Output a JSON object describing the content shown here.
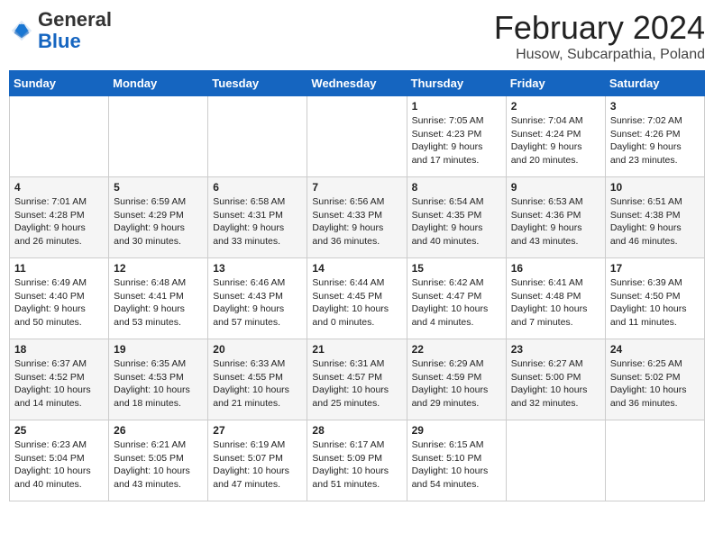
{
  "header": {
    "logo_general": "General",
    "logo_blue": "Blue",
    "main_title": "February 2024",
    "subtitle": "Husow, Subcarpathia, Poland"
  },
  "days_of_week": [
    "Sunday",
    "Monday",
    "Tuesday",
    "Wednesday",
    "Thursday",
    "Friday",
    "Saturday"
  ],
  "weeks": [
    [
      {
        "day": "",
        "text": ""
      },
      {
        "day": "",
        "text": ""
      },
      {
        "day": "",
        "text": ""
      },
      {
        "day": "",
        "text": ""
      },
      {
        "day": "1",
        "text": "Sunrise: 7:05 AM\nSunset: 4:23 PM\nDaylight: 9 hours and 17 minutes."
      },
      {
        "day": "2",
        "text": "Sunrise: 7:04 AM\nSunset: 4:24 PM\nDaylight: 9 hours and 20 minutes."
      },
      {
        "day": "3",
        "text": "Sunrise: 7:02 AM\nSunset: 4:26 PM\nDaylight: 9 hours and 23 minutes."
      }
    ],
    [
      {
        "day": "4",
        "text": "Sunrise: 7:01 AM\nSunset: 4:28 PM\nDaylight: 9 hours and 26 minutes."
      },
      {
        "day": "5",
        "text": "Sunrise: 6:59 AM\nSunset: 4:29 PM\nDaylight: 9 hours and 30 minutes."
      },
      {
        "day": "6",
        "text": "Sunrise: 6:58 AM\nSunset: 4:31 PM\nDaylight: 9 hours and 33 minutes."
      },
      {
        "day": "7",
        "text": "Sunrise: 6:56 AM\nSunset: 4:33 PM\nDaylight: 9 hours and 36 minutes."
      },
      {
        "day": "8",
        "text": "Sunrise: 6:54 AM\nSunset: 4:35 PM\nDaylight: 9 hours and 40 minutes."
      },
      {
        "day": "9",
        "text": "Sunrise: 6:53 AM\nSunset: 4:36 PM\nDaylight: 9 hours and 43 minutes."
      },
      {
        "day": "10",
        "text": "Sunrise: 6:51 AM\nSunset: 4:38 PM\nDaylight: 9 hours and 46 minutes."
      }
    ],
    [
      {
        "day": "11",
        "text": "Sunrise: 6:49 AM\nSunset: 4:40 PM\nDaylight: 9 hours and 50 minutes."
      },
      {
        "day": "12",
        "text": "Sunrise: 6:48 AM\nSunset: 4:41 PM\nDaylight: 9 hours and 53 minutes."
      },
      {
        "day": "13",
        "text": "Sunrise: 6:46 AM\nSunset: 4:43 PM\nDaylight: 9 hours and 57 minutes."
      },
      {
        "day": "14",
        "text": "Sunrise: 6:44 AM\nSunset: 4:45 PM\nDaylight: 10 hours and 0 minutes."
      },
      {
        "day": "15",
        "text": "Sunrise: 6:42 AM\nSunset: 4:47 PM\nDaylight: 10 hours and 4 minutes."
      },
      {
        "day": "16",
        "text": "Sunrise: 6:41 AM\nSunset: 4:48 PM\nDaylight: 10 hours and 7 minutes."
      },
      {
        "day": "17",
        "text": "Sunrise: 6:39 AM\nSunset: 4:50 PM\nDaylight: 10 hours and 11 minutes."
      }
    ],
    [
      {
        "day": "18",
        "text": "Sunrise: 6:37 AM\nSunset: 4:52 PM\nDaylight: 10 hours and 14 minutes."
      },
      {
        "day": "19",
        "text": "Sunrise: 6:35 AM\nSunset: 4:53 PM\nDaylight: 10 hours and 18 minutes."
      },
      {
        "day": "20",
        "text": "Sunrise: 6:33 AM\nSunset: 4:55 PM\nDaylight: 10 hours and 21 minutes."
      },
      {
        "day": "21",
        "text": "Sunrise: 6:31 AM\nSunset: 4:57 PM\nDaylight: 10 hours and 25 minutes."
      },
      {
        "day": "22",
        "text": "Sunrise: 6:29 AM\nSunset: 4:59 PM\nDaylight: 10 hours and 29 minutes."
      },
      {
        "day": "23",
        "text": "Sunrise: 6:27 AM\nSunset: 5:00 PM\nDaylight: 10 hours and 32 minutes."
      },
      {
        "day": "24",
        "text": "Sunrise: 6:25 AM\nSunset: 5:02 PM\nDaylight: 10 hours and 36 minutes."
      }
    ],
    [
      {
        "day": "25",
        "text": "Sunrise: 6:23 AM\nSunset: 5:04 PM\nDaylight: 10 hours and 40 minutes."
      },
      {
        "day": "26",
        "text": "Sunrise: 6:21 AM\nSunset: 5:05 PM\nDaylight: 10 hours and 43 minutes."
      },
      {
        "day": "27",
        "text": "Sunrise: 6:19 AM\nSunset: 5:07 PM\nDaylight: 10 hours and 47 minutes."
      },
      {
        "day": "28",
        "text": "Sunrise: 6:17 AM\nSunset: 5:09 PM\nDaylight: 10 hours and 51 minutes."
      },
      {
        "day": "29",
        "text": "Sunrise: 6:15 AM\nSunset: 5:10 PM\nDaylight: 10 hours and 54 minutes."
      },
      {
        "day": "",
        "text": ""
      },
      {
        "day": "",
        "text": ""
      }
    ]
  ]
}
